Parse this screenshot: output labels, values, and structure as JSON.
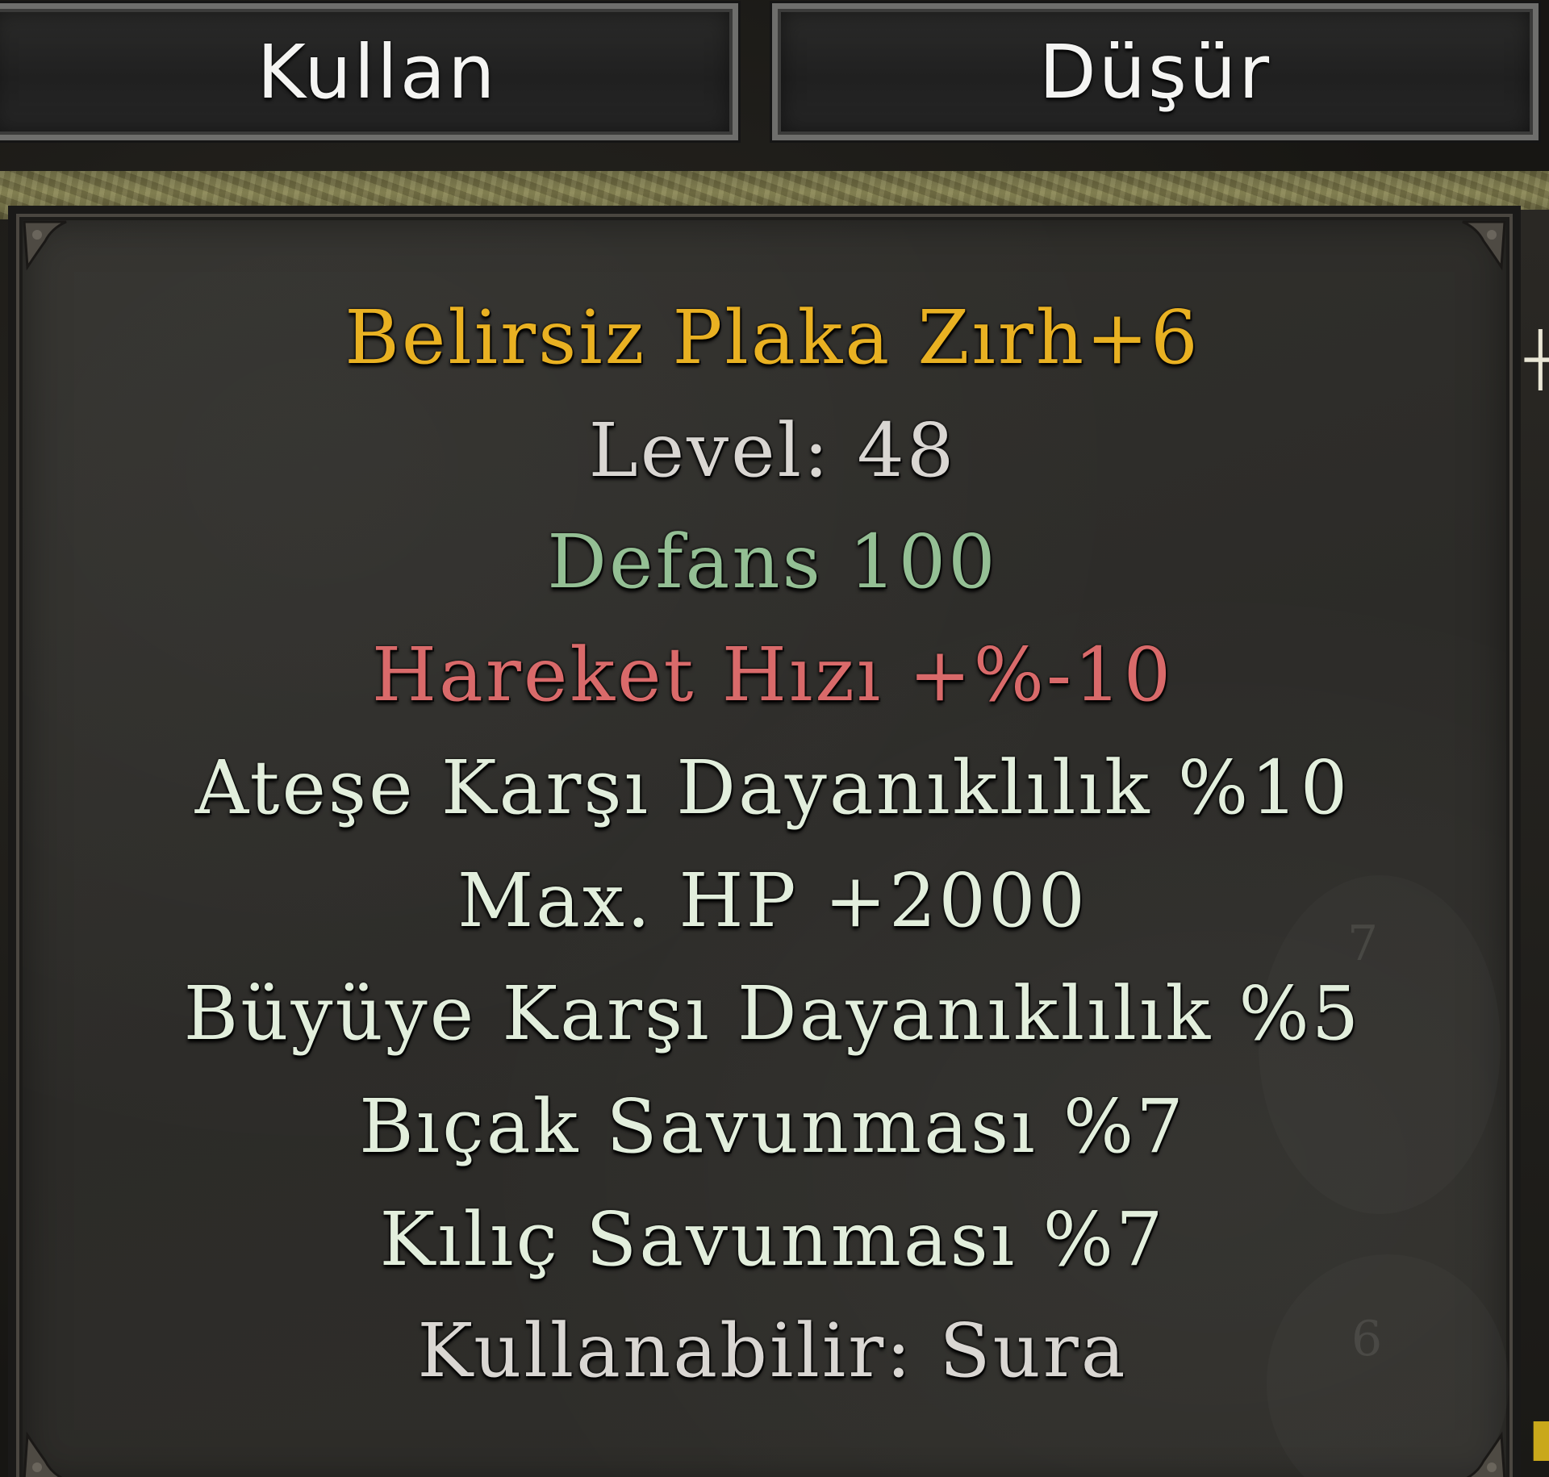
{
  "actions": {
    "use_label": "Kullan",
    "drop_label": "Düşür"
  },
  "tooltip": {
    "item_name": "Belirsiz Plaka Zırh+6",
    "level": "Level: 48",
    "defense": "Defans 100",
    "movement_speed": "Hareket Hızı +%-10",
    "fire_resistance": "Ateşe Karşı Dayanıklılık %10",
    "max_hp": "Max. HP +2000",
    "magic_resistance": "Büyüye Karşı Dayanıklılık %5",
    "dagger_defense": "Bıçak Savunması %7",
    "sword_defense": "Kılıç Savunması %7",
    "usable_by": "Kullanabilir:  Sura"
  },
  "colors": {
    "item_name": "#e9b122",
    "level": "#d9d6d2",
    "defense": "#94bf94",
    "movement_speed": "#d96a6a",
    "bonus": "#e2eedc",
    "usable_by": "#d9d6d2"
  }
}
